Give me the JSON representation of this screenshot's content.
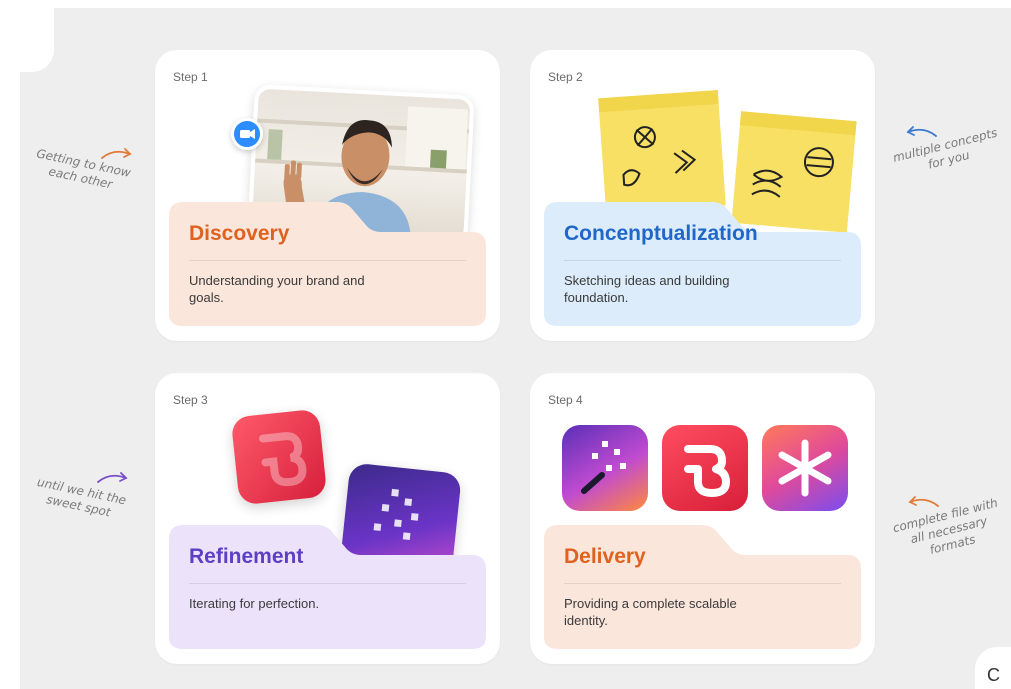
{
  "steps": [
    {
      "step": "Step 1",
      "title": "Discovery",
      "description": "Understanding your brand and goals.",
      "color": "#e0621f",
      "folder_color": "#fbe6dc"
    },
    {
      "step": "Step 2",
      "title": "Concenptualization",
      "description": "Sketching ideas and building foundation.",
      "color": "#1f67c8",
      "folder_color": "#dcecfa"
    },
    {
      "step": "Step 3",
      "title": "Refinement",
      "description": "Iterating for perfection.",
      "color": "#5b3fc4",
      "folder_color": "#ece3fb"
    },
    {
      "step": "Step 4",
      "title": "Delivery",
      "description": "Providing a complete scalable identity.",
      "color": "#e0621f",
      "folder_color": "#fbe6dc"
    }
  ],
  "annotations": [
    {
      "line1": "Getting to know",
      "line2": "each other",
      "arrow_color": "#e27b3a"
    },
    {
      "line1": "multiple concepts",
      "line2": "for you",
      "arrow_color": "#3a7ad0"
    },
    {
      "line1": "until we hit the",
      "line2": "sweet spot",
      "arrow_color": "#7a4fc8"
    },
    {
      "line1": "complete file with",
      "line2": "all necessary formats",
      "arrow_color": "#e27b3a"
    }
  ],
  "corner_glyph": "C"
}
